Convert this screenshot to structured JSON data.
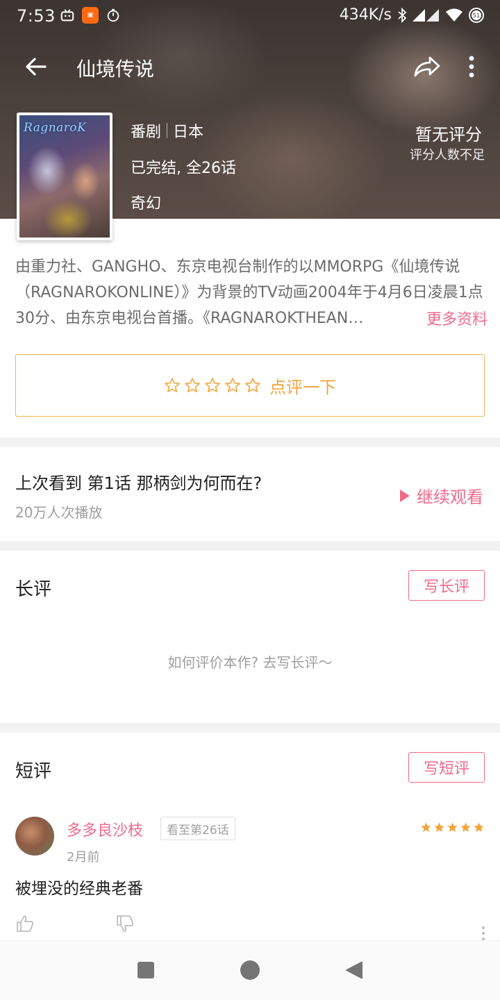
{
  "status_bar": {
    "time": "7:53",
    "speed": "434K/s",
    "battery": "51"
  },
  "toolbar": {
    "title": "仙境传说"
  },
  "cover": {
    "logo_text": "RagnaroK"
  },
  "info": {
    "type": "番剧",
    "region": "日本",
    "status": "已完结, 全26话",
    "genre": "奇幻",
    "rating_main": "暂无评分",
    "rating_sub": "评分人数不足"
  },
  "description": {
    "text": "由重力社、GANGHO、东京电视台制作的以MMORPG《仙境传说（RAGNAROKONLINE）》为背景的TV动画2004年于4月6日凌晨1点30分、由东京电视台首播。《RAGNAROKTHEAN…",
    "more_label": "更多资料"
  },
  "rate_box": {
    "label": "点评一下",
    "star_count": 5
  },
  "continue": {
    "last_watched": "上次看到 第1话 那柄剑为何而在?",
    "play_count": "20万人次播放",
    "button_label": "继续观看"
  },
  "long_review": {
    "title": "长评",
    "write_label": "写长评",
    "empty_hint": "如何评价本作? 去写长评～"
  },
  "short_review": {
    "title": "短评",
    "write_label": "写短评",
    "items": [
      {
        "user": "多多良沙枝",
        "badge": "看至第26话",
        "time": "2月前",
        "text": "被埋没的经典老番",
        "stars": 5
      }
    ]
  },
  "colors": {
    "accent_pink": "#f06a8b",
    "accent_orange": "#f2a43a"
  }
}
